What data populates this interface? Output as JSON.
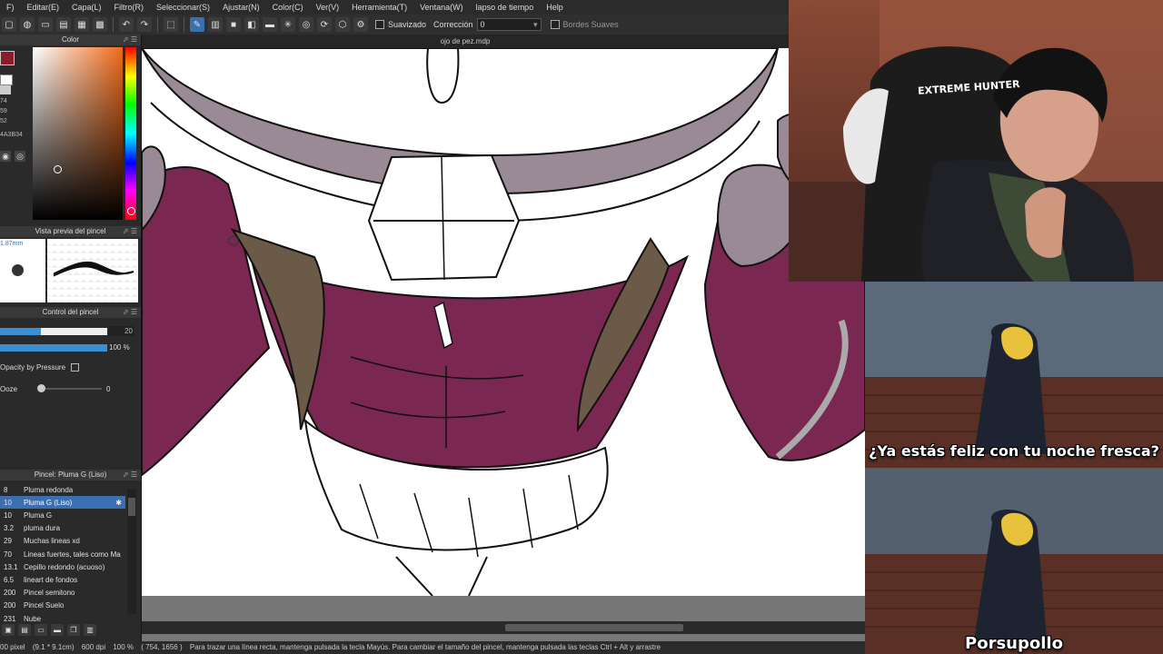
{
  "menu": [
    "F)",
    "Editar(E)",
    "Capa(L)",
    "Filtro(R)",
    "Seleccionar(S)",
    "Ajustar(N)",
    "Color(C)",
    "Ver(V)",
    "Herramienta(T)",
    "Ventana(W)",
    "lapso de tiempo",
    "Help"
  ],
  "toolbar": {
    "smoothing_label": "Suavizado",
    "correction_label": "Corrección",
    "correction_value": "0",
    "soft_edges_label": "Bordes Suaves"
  },
  "color_panel": {
    "title": "Color",
    "hsv": [
      "74",
      "59",
      "52"
    ],
    "hex": "4A3B34"
  },
  "brush_preview": {
    "title": "Vista previa del pincel",
    "size": "1.87mm"
  },
  "brush_control": {
    "title": "Control del pincel",
    "size_value": "20",
    "size_fraction": 0.38,
    "opacity_value": "100 %",
    "opacity_fraction": 1.0,
    "opacity_by_pressure_label": "Opacity by Pressure",
    "ooze_label": "Ooze",
    "ooze_value": "0"
  },
  "brush_list": {
    "title": "Pincel: Pluma G (Liso)",
    "items": [
      {
        "size": "8",
        "name": "Pluma redonda",
        "selected": false
      },
      {
        "size": "10",
        "name": "Pluma G (Liso)",
        "selected": true
      },
      {
        "size": "10",
        "name": "Pluma G",
        "selected": false
      },
      {
        "size": "3.2",
        "name": "pluma dura",
        "selected": false
      },
      {
        "size": "29",
        "name": "Muchas lineas xd",
        "selected": false
      },
      {
        "size": "70",
        "name": "Lineas fuertes, tales como Ma",
        "selected": false
      },
      {
        "size": "13.1",
        "name": "Cepillo redondo (acuoso)",
        "selected": false
      },
      {
        "size": "6.5",
        "name": "lineart de fondos",
        "selected": false
      },
      {
        "size": "200",
        "name": "Pincel semitono",
        "selected": false
      },
      {
        "size": "200",
        "name": "Pincel Suelo",
        "selected": false
      },
      {
        "size": "231",
        "name": "Nube",
        "selected": false
      }
    ]
  },
  "document": {
    "title": "ojo de pez.mdp"
  },
  "status": {
    "unit": "00 pixel",
    "size": "(9.1 * 9.1cm)",
    "dpi": "600 dpi",
    "zoom": "100 %",
    "coords": "( 754, 1656 )",
    "hint": "Para trazar una línea recta, mantenga pulsada la tecla Mayús. Para cambiar el tamaño del pincel, mantenga pulsada las teclas Ctrl + Alt y arrastre"
  },
  "webcam": {
    "chair_text": "EXTREME HUNTER"
  },
  "meme": {
    "caption_top": "¿Ya estás feliz con tu noche fresca?",
    "caption_bottom": "Porsupollo"
  },
  "colors": {
    "fill_purple": "#7a2851",
    "hat_gray": "#9a8a96",
    "hair_brown": "#6b5a47",
    "accent_blue": "#3b6fb0"
  }
}
